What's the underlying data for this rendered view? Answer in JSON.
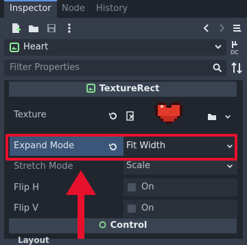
{
  "tabs": [
    {
      "label": "Inspector",
      "active": true
    },
    {
      "label": "Node",
      "active": false
    },
    {
      "label": "History",
      "active": false
    }
  ],
  "toolbar": {
    "icons": [
      "new-resource-icon",
      "open-folder-icon",
      "save-icon",
      "more-vert-icon"
    ],
    "nav": [
      "back-icon",
      "forward-icon",
      "history-icon"
    ]
  },
  "node_selector": {
    "name": "Heart",
    "icon": "node-icon"
  },
  "filter": {
    "placeholder": "Filter Properties"
  },
  "sections": {
    "texture_rect": "TextureRect",
    "control": "Control",
    "layout": "Layout"
  },
  "properties": {
    "texture": {
      "label": "Texture"
    },
    "expand_mode": {
      "label": "Expand Mode",
      "value": "Fit Width"
    },
    "stretch_mode": {
      "label": "Stretch Mode",
      "value": "Scale"
    },
    "flip_h": {
      "label": "Flip H",
      "value": "On"
    },
    "flip_v": {
      "label": "Flip V",
      "value": "On"
    }
  },
  "colors": {
    "accent": "#5f95e6",
    "highlight": "#e8112d",
    "heart": "#e23a2a",
    "section_icon_green": "#8eef97"
  }
}
